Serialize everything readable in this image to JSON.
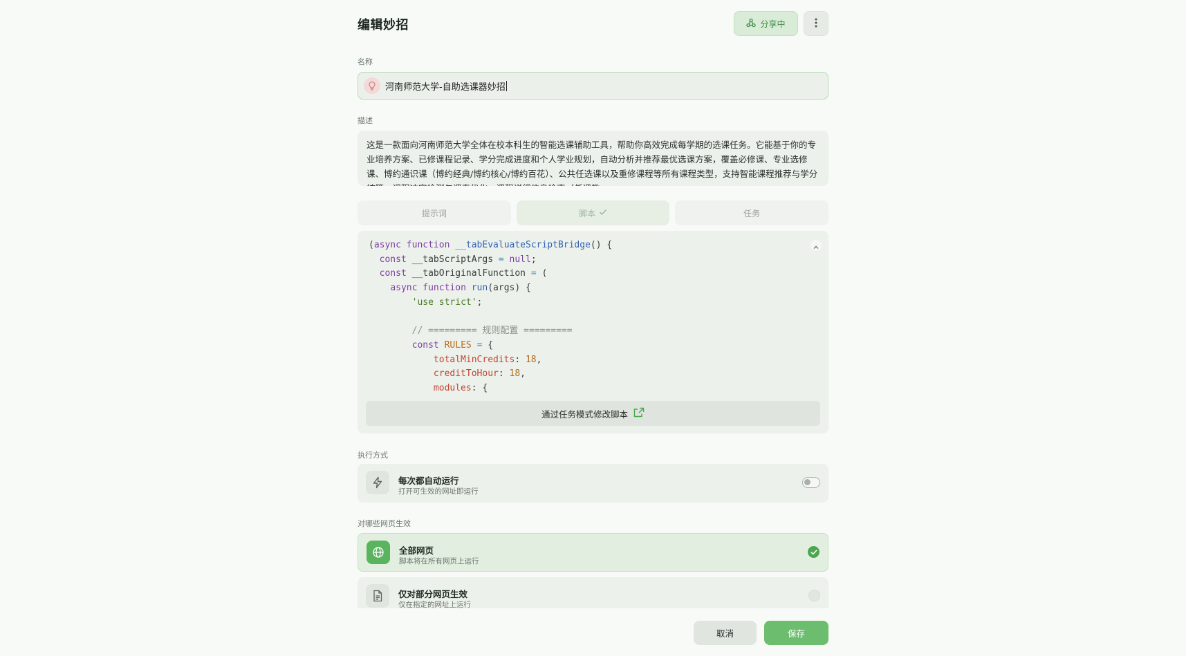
{
  "header": {
    "title": "编辑妙招",
    "share_label": "分享中"
  },
  "name_field": {
    "label": "名称",
    "value": "河南师范大学-自助选课器妙招"
  },
  "description_field": {
    "label": "描述",
    "value": "这是一款面向河南师范大学全体在校本科生的智能选课辅助工具，帮助你高效完成每学期的选课任务。它能基于你的专业培养方案、已修课程记录、学分完成进度和个人学业规划，自动分析并推荐最优选课方案，覆盖必修课、专业选修课、博约通识课（博约经典/博约核心/博约百花）、公共任选课以及重修课程等所有课程类型，支持智能课程推荐与学分核算、课程冲突检测与课表优化、课程详细信息检索（任课教"
  },
  "tabs": [
    {
      "label": "提示词"
    },
    {
      "label": "脚本"
    },
    {
      "label": "任务"
    }
  ],
  "code": {
    "lines": [
      "(async function __tabEvaluateScriptBridge() {",
      "  const __tabScriptArgs = null;",
      "  const __tabOriginalFunction = (",
      "    async function run(args) {",
      "        'use strict';",
      "",
      "        // ========= 规则配置 =========",
      "        const RULES = {",
      "            totalMinCredits: 18,",
      "            creditToHour: 18,",
      "            modules: {"
    ],
    "modify_button": "通过任务模式修改脚本"
  },
  "execution": {
    "label": "执行方式",
    "auto_run": {
      "title": "每次都自动运行",
      "subtitle": "打开可生效的网址即运行",
      "enabled": false
    }
  },
  "scope": {
    "label": "对哪些网页生效",
    "options": [
      {
        "title": "全部网页",
        "subtitle": "脚本将在所有网页上运行",
        "selected": true
      },
      {
        "title": "仅对部分网页生效",
        "subtitle": "仅在指定的网址上运行",
        "selected": false
      }
    ]
  },
  "footer": {
    "cancel_label": "取消",
    "save_label": "保存"
  },
  "colors": {
    "accent": "#6dbd6f",
    "share_text": "#3f8a44",
    "background": "#f7faf6"
  }
}
